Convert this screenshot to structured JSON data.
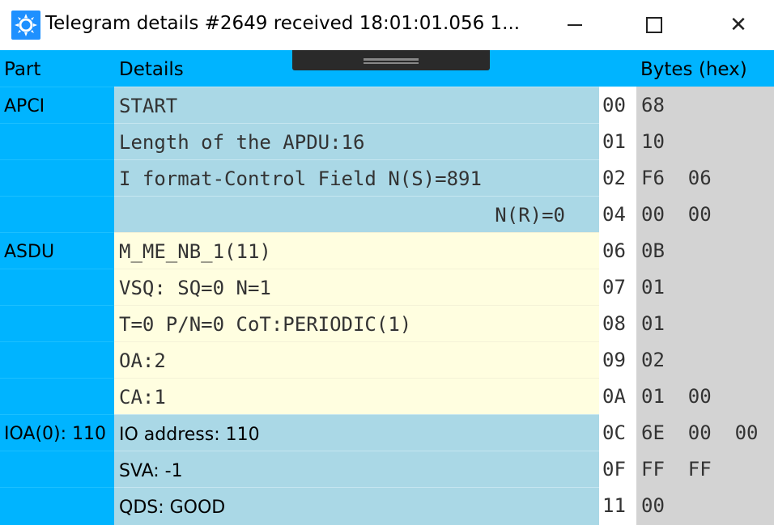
{
  "window": {
    "title": "Telegram details #2649 received 18:01:01.056 1...",
    "icon": "app-gear-icon",
    "minimize_icon": "minimize-icon",
    "maximize_icon": "maximize-icon",
    "close_icon": "close-icon",
    "close_glyph": "✕"
  },
  "colors": {
    "header_bg": "#00b4ff",
    "apci_bg": "#aad8e6",
    "asdu_bg": "#fffee0",
    "bytes_bg": "#d3d3d3"
  },
  "headers": {
    "part": "Part",
    "details": "Details",
    "bytes": "Bytes (hex)"
  },
  "parts": [
    {
      "label": "APCI"
    },
    {
      "label": "ASDU"
    },
    {
      "label": "IOA(0): 110"
    }
  ],
  "rows": [
    {
      "details": "START",
      "offset": "00",
      "bytes": "68"
    },
    {
      "details": "Length of the APDU:16",
      "offset": "01",
      "bytes": "10"
    },
    {
      "details": "I format-Control Field N(S)=891",
      "offset": "02",
      "bytes": "F6  06"
    },
    {
      "details": "N(R)=0",
      "offset": "04",
      "bytes": "00  00"
    },
    {
      "details": "M_ME_NB_1(11)",
      "offset": "06",
      "bytes": "0B"
    },
    {
      "details": "VSQ: SQ=0 N=1",
      "offset": "07",
      "bytes": "01"
    },
    {
      "details": "T=0 P/N=0 CoT:PERIODIC(1)",
      "offset": "08",
      "bytes": "01"
    },
    {
      "details": "OA:2",
      "offset": "09",
      "bytes": "02"
    },
    {
      "details": "CA:1",
      "offset": "0A",
      "bytes": "01  00"
    },
    {
      "details": "IO address: 110",
      "offset": "0C",
      "bytes": "6E  00  00"
    },
    {
      "details": "SVA: -1",
      "offset": "0F",
      "bytes": "FF  FF"
    },
    {
      "details": "QDS: GOOD",
      "offset": "11",
      "bytes": "00"
    }
  ]
}
